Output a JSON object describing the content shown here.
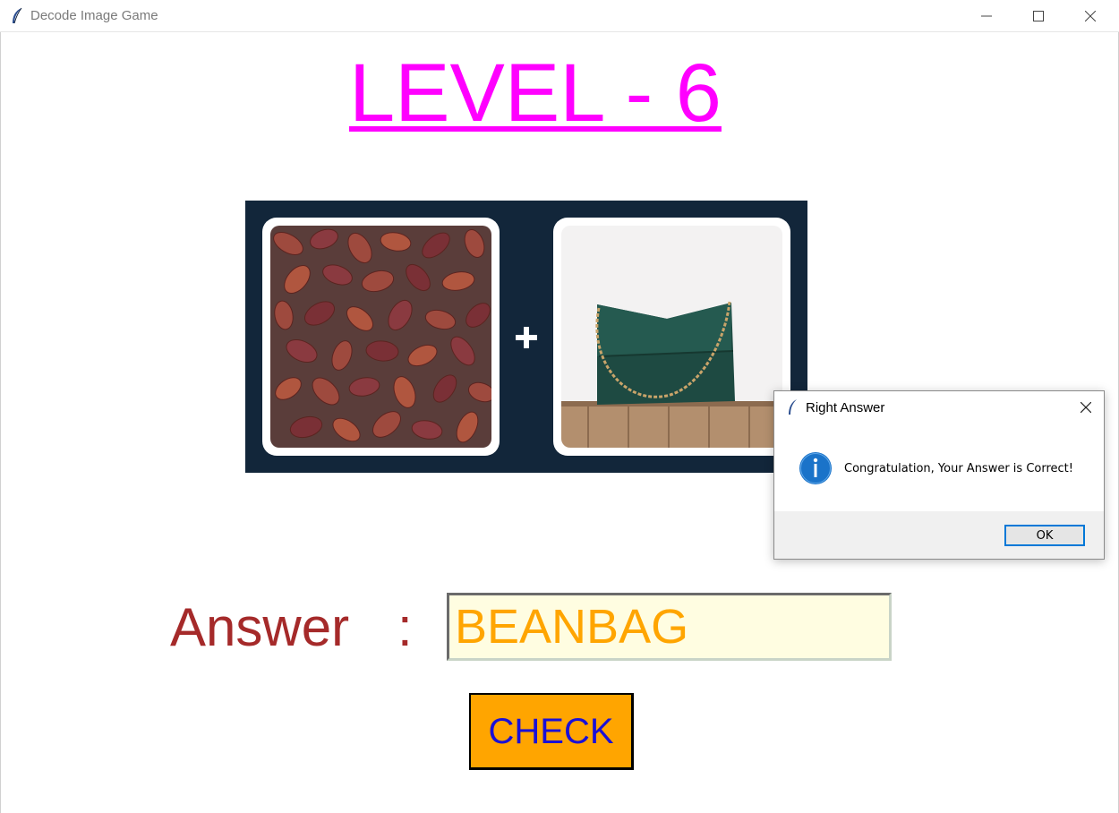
{
  "window": {
    "title": "Decode Image Game",
    "icon": "feather-icon",
    "controls": [
      "minimize-icon",
      "maximize-icon",
      "close-icon"
    ]
  },
  "game": {
    "level_title": "LEVEL - 6",
    "puzzle": {
      "left_image": "kidney-beans",
      "operator": "plus-icon",
      "right_image": "green-handbag"
    },
    "answer_label": "Answer",
    "answer_colon": ":",
    "answer_value": "BEANBAG",
    "check_label": "CHECK"
  },
  "dialog": {
    "title": "Right Answer",
    "icon": "info-icon",
    "message": "Congratulation, Your Answer is Correct!",
    "ok_label": "OK"
  },
  "colors": {
    "level_title": "#ff00ff",
    "answer_label": "#a52a2a",
    "answer_text": "#ffa500",
    "answer_bg": "#fffde1",
    "check_bg": "#ffa500",
    "check_text": "#1a10d6",
    "puzzle_bg": "#12263a"
  }
}
